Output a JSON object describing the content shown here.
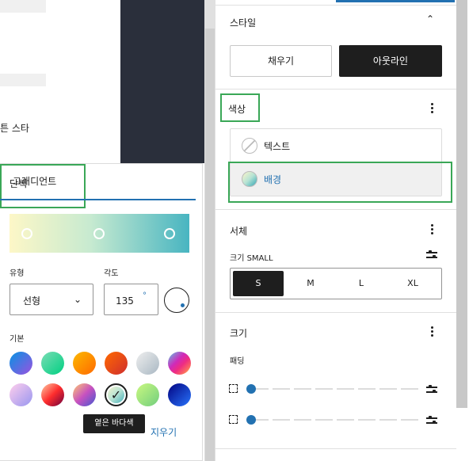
{
  "editor": {
    "partial_text": "튼 스타"
  },
  "popover": {
    "tabs": {
      "solid": "단색",
      "gradient": "그래디언트"
    },
    "type_label": "유형",
    "type_value": "선형",
    "angle_label": "각도",
    "angle_value": "135",
    "angle_unit": "°",
    "default_label": "기본",
    "gradient_stops": [
      "#fdf7c7",
      "#c7ead0",
      "#48b5c1"
    ],
    "swatches": [
      {
        "name": "vivid-cyan-blue-to-vivid-purple",
        "bg": "linear-gradient(135deg,#0693e3,#9b51e0)"
      },
      {
        "name": "light-green-cyan-to-vivid-green-cyan",
        "bg": "linear-gradient(135deg,#7adcb4,#00d082)"
      },
      {
        "name": "luminous-vivid-amber-to-orange",
        "bg": "linear-gradient(135deg,#fcb900,#ff6900)"
      },
      {
        "name": "luminous-vivid-orange-to-red",
        "bg": "linear-gradient(135deg,#ff6900,#cf2e2e)"
      },
      {
        "name": "very-light-gray-to-cyan-bluish-gray",
        "bg": "linear-gradient(135deg,#eeeeee,#a9b8c3)"
      },
      {
        "name": "cool-to-warm-spectrum",
        "bg": "linear-gradient(135deg,#4aeadc,#9778d1,#cf2aba,#ee2c82,#fb6962,#fef84c)"
      },
      {
        "name": "blush-light-purple",
        "bg": "linear-gradient(135deg,#ffceec,#9896f0)"
      },
      {
        "name": "blush-bordeaux",
        "bg": "linear-gradient(135deg,#fecda5,#fe2d2d,#6b003e)"
      },
      {
        "name": "luminous-dusk",
        "bg": "linear-gradient(135deg,#ffcb70,#c751c0,#4158d0)"
      },
      {
        "name": "pale-ocean",
        "bg": "linear-gradient(135deg,#fff5cb,#b6e3d4,#33a7b5)"
      },
      {
        "name": "electric-grass",
        "bg": "linear-gradient(135deg,#caf880,#71ce7e)"
      },
      {
        "name": "midnight",
        "bg": "linear-gradient(135deg,#020381,#2874fc)"
      }
    ],
    "tooltip": "옅은 바다색",
    "clear_label": "지우기"
  },
  "sidebar": {
    "style": {
      "title": "스타일",
      "fill_label": "채우기",
      "outline_label": "아웃라인"
    },
    "color": {
      "title": "색상",
      "items": [
        "텍스트",
        "배경"
      ]
    },
    "typography": {
      "title": "서체",
      "size_label": "크기 SMALL",
      "sizes": [
        "S",
        "M",
        "L",
        "XL"
      ]
    },
    "dimensions": {
      "title": "크기",
      "padding_label": "패딩"
    }
  },
  "colors": {
    "accent": "#2271b1",
    "highlight": "#3aa757",
    "dark": "#1e1e1e"
  }
}
